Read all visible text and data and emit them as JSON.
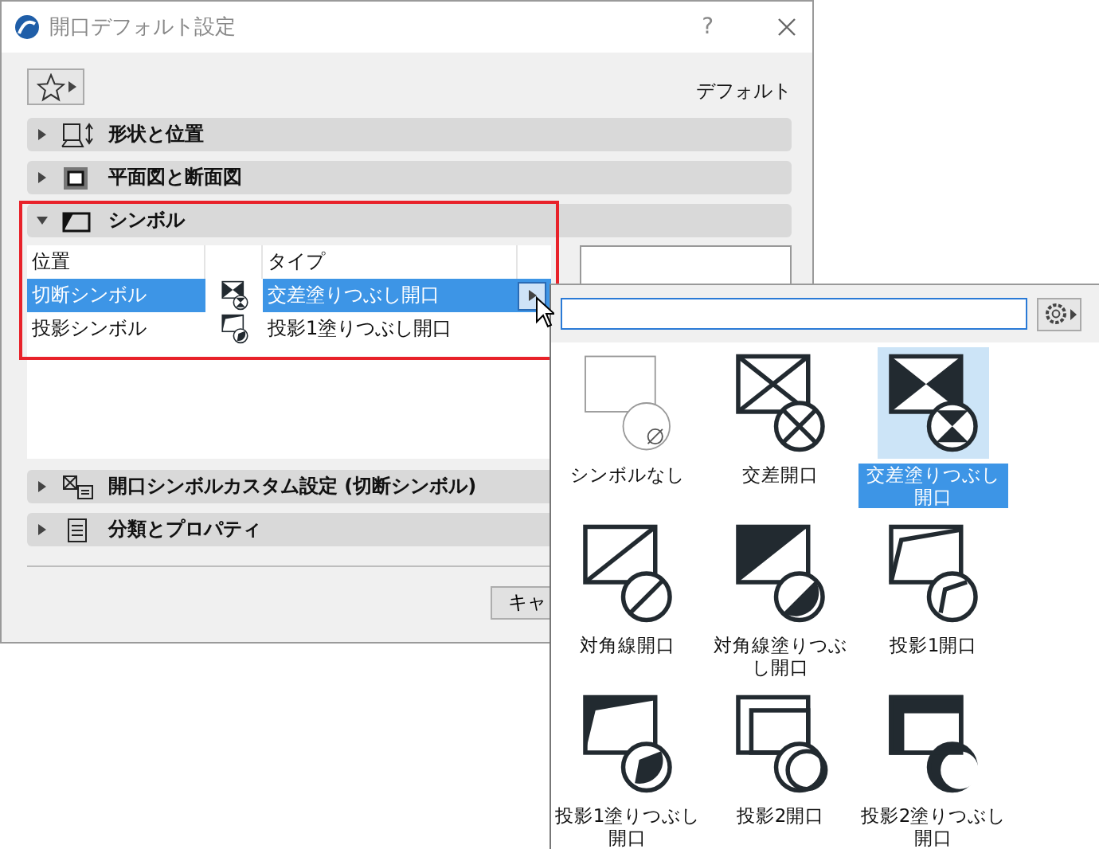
{
  "window": {
    "title": "開口デフォルト設定",
    "help": "?"
  },
  "toolbar": {
    "default_label": "デフォルト"
  },
  "sections": [
    {
      "label": "形状と位置",
      "kind": "shape",
      "expanded": false
    },
    {
      "label": "平面図と断面図",
      "kind": "plan",
      "expanded": false
    },
    {
      "label": "シンボル",
      "kind": "symbol",
      "expanded": true,
      "table": {
        "columns": {
          "position": "位置",
          "type": "タイプ"
        },
        "rows": [
          {
            "position": "切断シンボル",
            "type": "交差塗りつぶし開口",
            "kind": "cross-filled",
            "selected": true
          },
          {
            "position": "投影シンボル",
            "type": "投影1塗りつぶし開口",
            "kind": "projection1-filled",
            "selected": false
          }
        ]
      }
    },
    {
      "label": "開口シンボルカスタム設定 (切断シンボル)",
      "kind": "custom",
      "expanded": false
    },
    {
      "label": "分類とプロパティ",
      "kind": "list",
      "expanded": false
    }
  ],
  "footer": {
    "cancel_button": "キャ"
  },
  "popup": {
    "options": [
      {
        "label": "シンボルなし",
        "kind": "none",
        "selected": false
      },
      {
        "label": "交差開口",
        "kind": "cross",
        "selected": false
      },
      {
        "label": "交差塗りつぶし開口",
        "kind": "cross-filled",
        "selected": true
      },
      {
        "label": "対角線開口",
        "kind": "diagonal",
        "selected": false
      },
      {
        "label": "対角線塗りつぶし開口",
        "kind": "diagonal-filled",
        "selected": false
      },
      {
        "label": "投影1開口",
        "kind": "projection1",
        "selected": false
      },
      {
        "label": "投影1塗りつぶし開口",
        "kind": "projection1-filled",
        "selected": false
      },
      {
        "label": "投影2開口",
        "kind": "projection2",
        "selected": false
      },
      {
        "label": "投影2塗りつぶし開口",
        "kind": "projection2-filled",
        "selected": false
      }
    ]
  }
}
